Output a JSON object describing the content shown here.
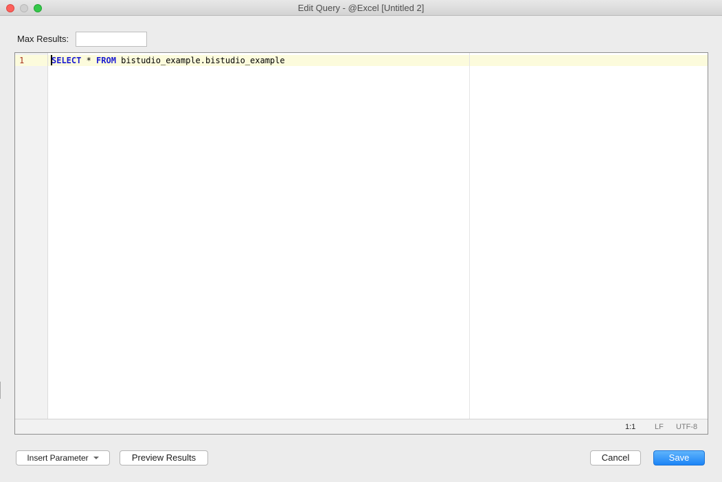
{
  "window": {
    "title": "Edit Query - @Excel [Untitled 2]"
  },
  "max_results": {
    "label": "Max Results:",
    "value": "",
    "placeholder": ""
  },
  "editor": {
    "line_number": "1",
    "code": {
      "kw_select": "SELECT",
      "star": " * ",
      "kw_from": "FROM",
      "table": " bistudio_example.bistudio_example"
    },
    "status": {
      "position": "1:1",
      "line_ending": "LF",
      "encoding": "UTF-8"
    }
  },
  "buttons": {
    "insert_parameter": "Insert Parameter",
    "preview_results": "Preview Results",
    "cancel": "Cancel",
    "save": "Save"
  },
  "colors": {
    "save_button": "#1c84f6",
    "keyword": "#1a1ad2",
    "line_number": "#a8321c",
    "current_line": "#fcfbdc"
  }
}
